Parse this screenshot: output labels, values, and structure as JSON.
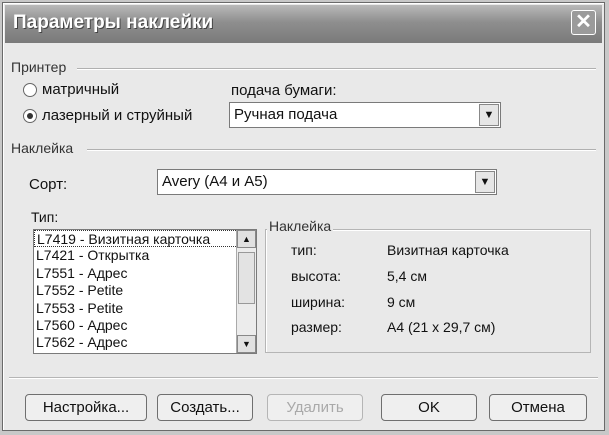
{
  "window": {
    "title": "Параметры наклейки",
    "close_glyph": "✕"
  },
  "printer": {
    "group_label": "Принтер",
    "option_dot_matrix": "матричный",
    "option_laser": "лазерный и струйный",
    "selected": "лазерный и струйный",
    "feed_label": "подача бумаги:",
    "feed_value": "Ручная подача"
  },
  "label": {
    "group_label": "Наклейка",
    "sort_label": "Сорт:",
    "sort_value": "Avery (A4 и A5)",
    "type_label": "Тип:",
    "types": [
      "L7419 - Визитная карточка",
      "L7421 - Открытка",
      "L7551 - Адрес",
      "L7552 - Petite",
      "L7553 - Petite",
      "L7560 - Адрес",
      "L7562 - Адрес"
    ],
    "selected_type": "L7419 - Визитная карточка"
  },
  "info": {
    "group_label": "Наклейка",
    "type_label": "тип:",
    "type_value": "Визитная карточка",
    "height_label": "высота:",
    "height_value": "5,4 см",
    "width_label": "ширина:",
    "width_value": "9 см",
    "size_label": "размер:",
    "size_value": "A4 (21 x 29,7 см)"
  },
  "buttons": {
    "setup": "Настройка...",
    "create": "Создать...",
    "delete": "Удалить",
    "ok": "OK",
    "cancel": "Отмена"
  },
  "icons": {
    "dropdown": "▼",
    "scroll_up": "▲",
    "scroll_down": "▼"
  }
}
